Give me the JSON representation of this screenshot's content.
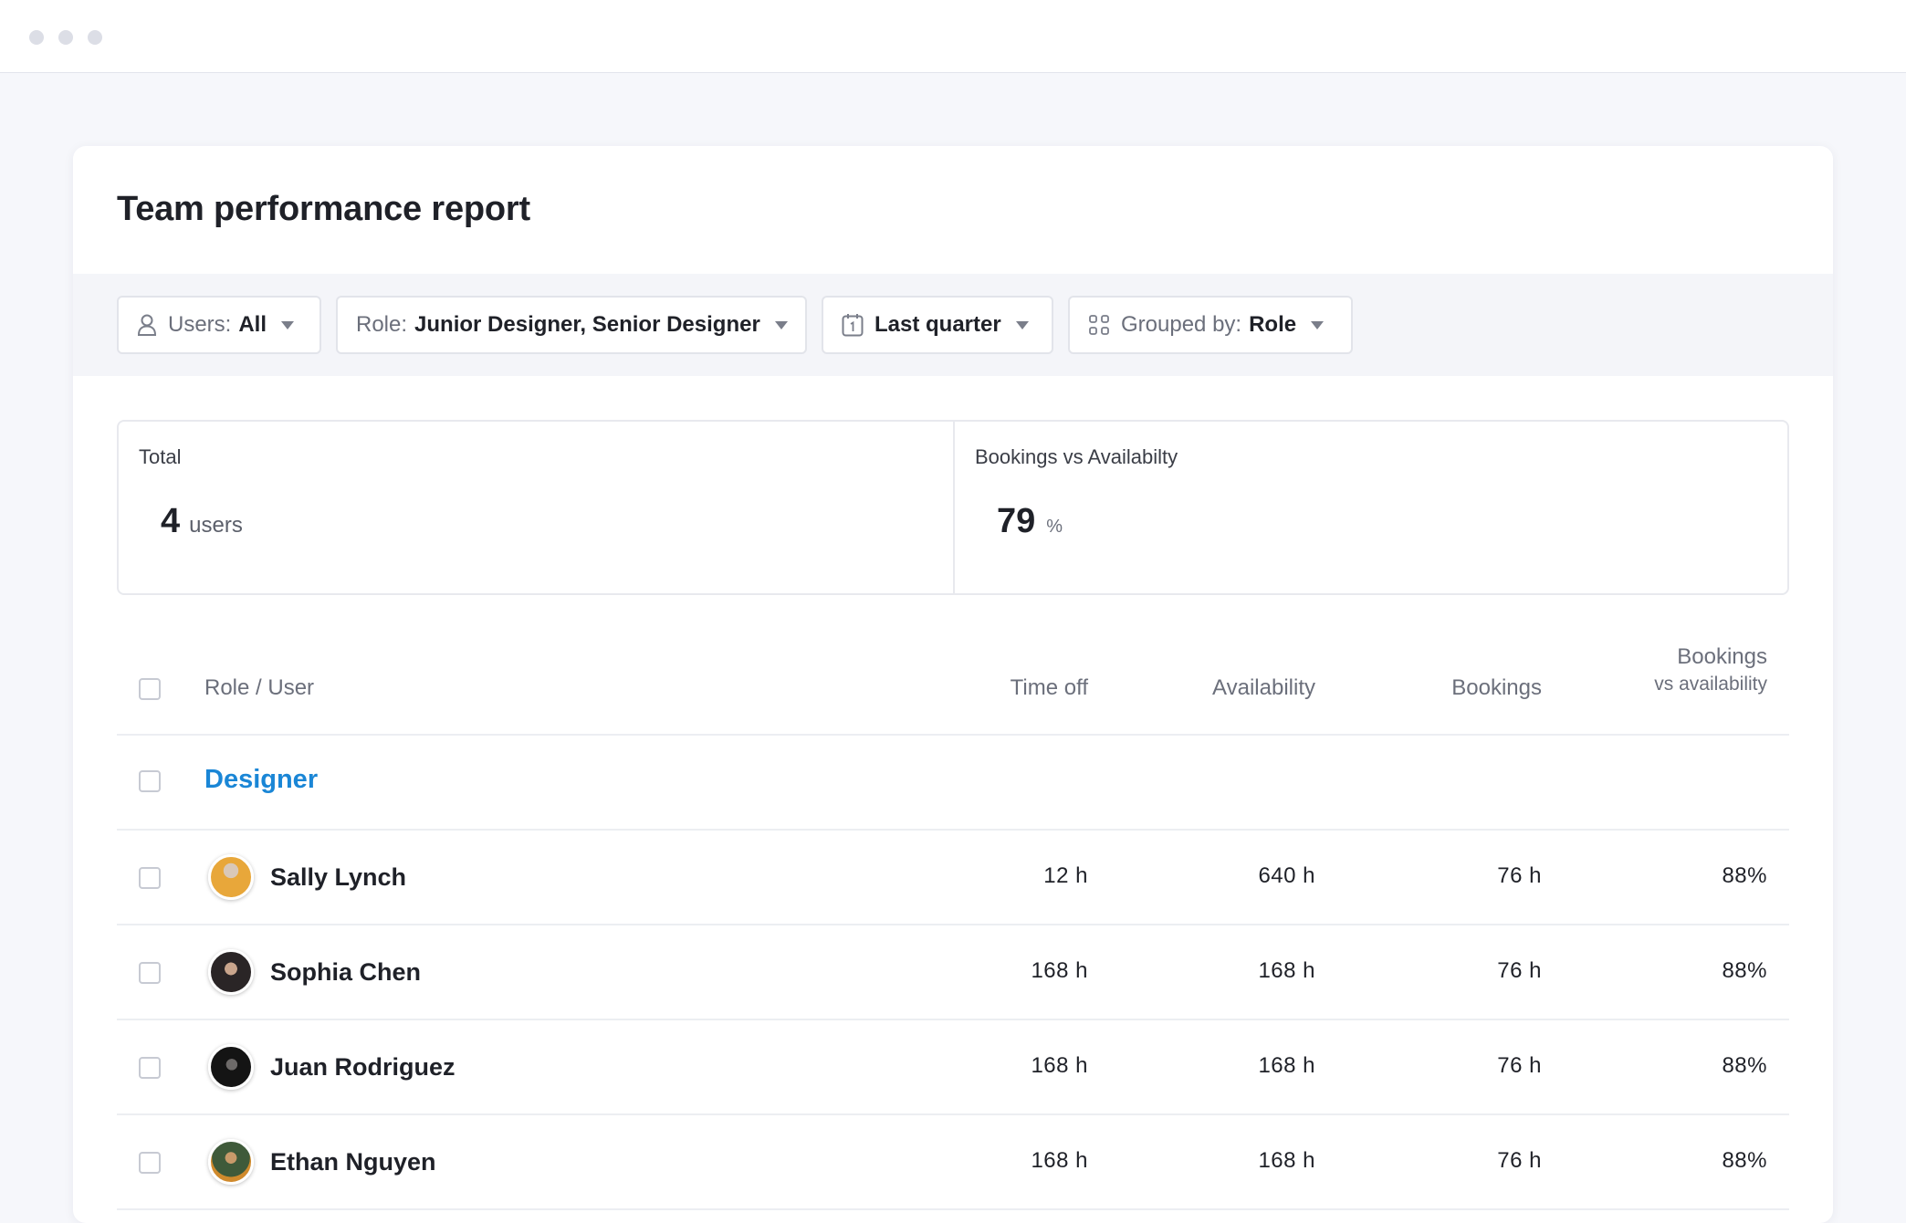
{
  "report": {
    "title": "Team performance report"
  },
  "filters": [
    {
      "label": "Users:",
      "value": "All",
      "icon": "user-icon"
    },
    {
      "label": "Role:",
      "value": "Junior Designer, Senior Designer",
      "icon": ""
    },
    {
      "label": "",
      "value": "Last quarter",
      "icon": "calendar-icon"
    },
    {
      "label": "Grouped by:",
      "value": "Role",
      "icon": "grid-icon"
    }
  ],
  "stats": {
    "total": {
      "label": "Total",
      "value": "4",
      "unit": "users"
    },
    "bookings_vs_availability": {
      "label": "Bookings vs Availabilty",
      "value": "79",
      "unit": "%"
    }
  },
  "table": {
    "headers": {
      "role_user": "Role / User",
      "time_off": "Time off",
      "availability": "Availability",
      "bookings": "Bookings",
      "bva_line1": "Bookings",
      "bva_line2": "vs availability"
    },
    "group": {
      "name": "Designer"
    },
    "rows": [
      {
        "name": "Sally Lynch",
        "time_off": "12 h",
        "availability": "640 h",
        "bookings": "76 h",
        "bva": "88%"
      },
      {
        "name": "Sophia Chen",
        "time_off": "168 h",
        "availability": "168 h",
        "bookings": "76 h",
        "bva": "88%"
      },
      {
        "name": "Juan Rodriguez",
        "time_off": "168 h",
        "availability": "168 h",
        "bookings": "76 h",
        "bva": "88%"
      },
      {
        "name": "Ethan Nguyen",
        "time_off": "168 h",
        "availability": "168 h",
        "bookings": "76 h",
        "bva": "88%"
      }
    ]
  },
  "colors": {
    "accent": "#1a86d6",
    "background": "#f6f7fb",
    "border": "#e2e4ea"
  }
}
